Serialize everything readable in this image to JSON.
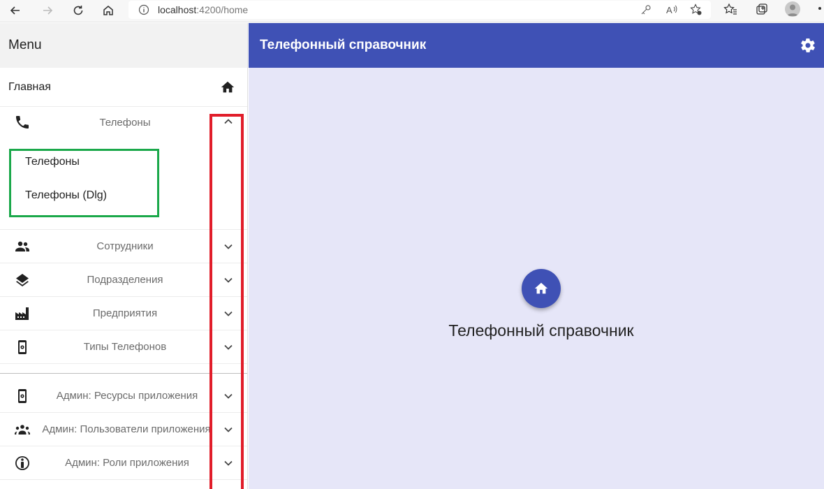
{
  "browser": {
    "url_host": "localhost",
    "url_rest": ":4200/home"
  },
  "sidebar": {
    "header": "Menu",
    "home_label": "Главная",
    "expanded_panel": {
      "label": "Телефоны",
      "icon": "phone-icon",
      "sub_items": [
        "Телефоны",
        "Телефоны (Dlg)"
      ]
    },
    "panels": [
      {
        "label": "Сотрудники",
        "icon": "people-icon"
      },
      {
        "label": "Подразделения",
        "icon": "layers-icon"
      },
      {
        "label": "Предприятия",
        "icon": "factory-icon"
      },
      {
        "label": "Типы Телефонов",
        "icon": "phone-settings-icon"
      }
    ],
    "admin_panels": [
      {
        "label": "Админ: Ресурсы приложения",
        "icon": "phone-settings-icon"
      },
      {
        "label": "Админ: Пользователи приложения",
        "icon": "groups-icon"
      },
      {
        "label": "Админ: Роли приложения",
        "icon": "info-person-icon"
      }
    ]
  },
  "toolbar": {
    "title": "Телефонный справочник",
    "settings_icon": "gear-icon",
    "color": "#3f51b5"
  },
  "main": {
    "title": "Телефонный справочник",
    "fab_icon": "home-icon",
    "background": "#e6e6f8"
  }
}
